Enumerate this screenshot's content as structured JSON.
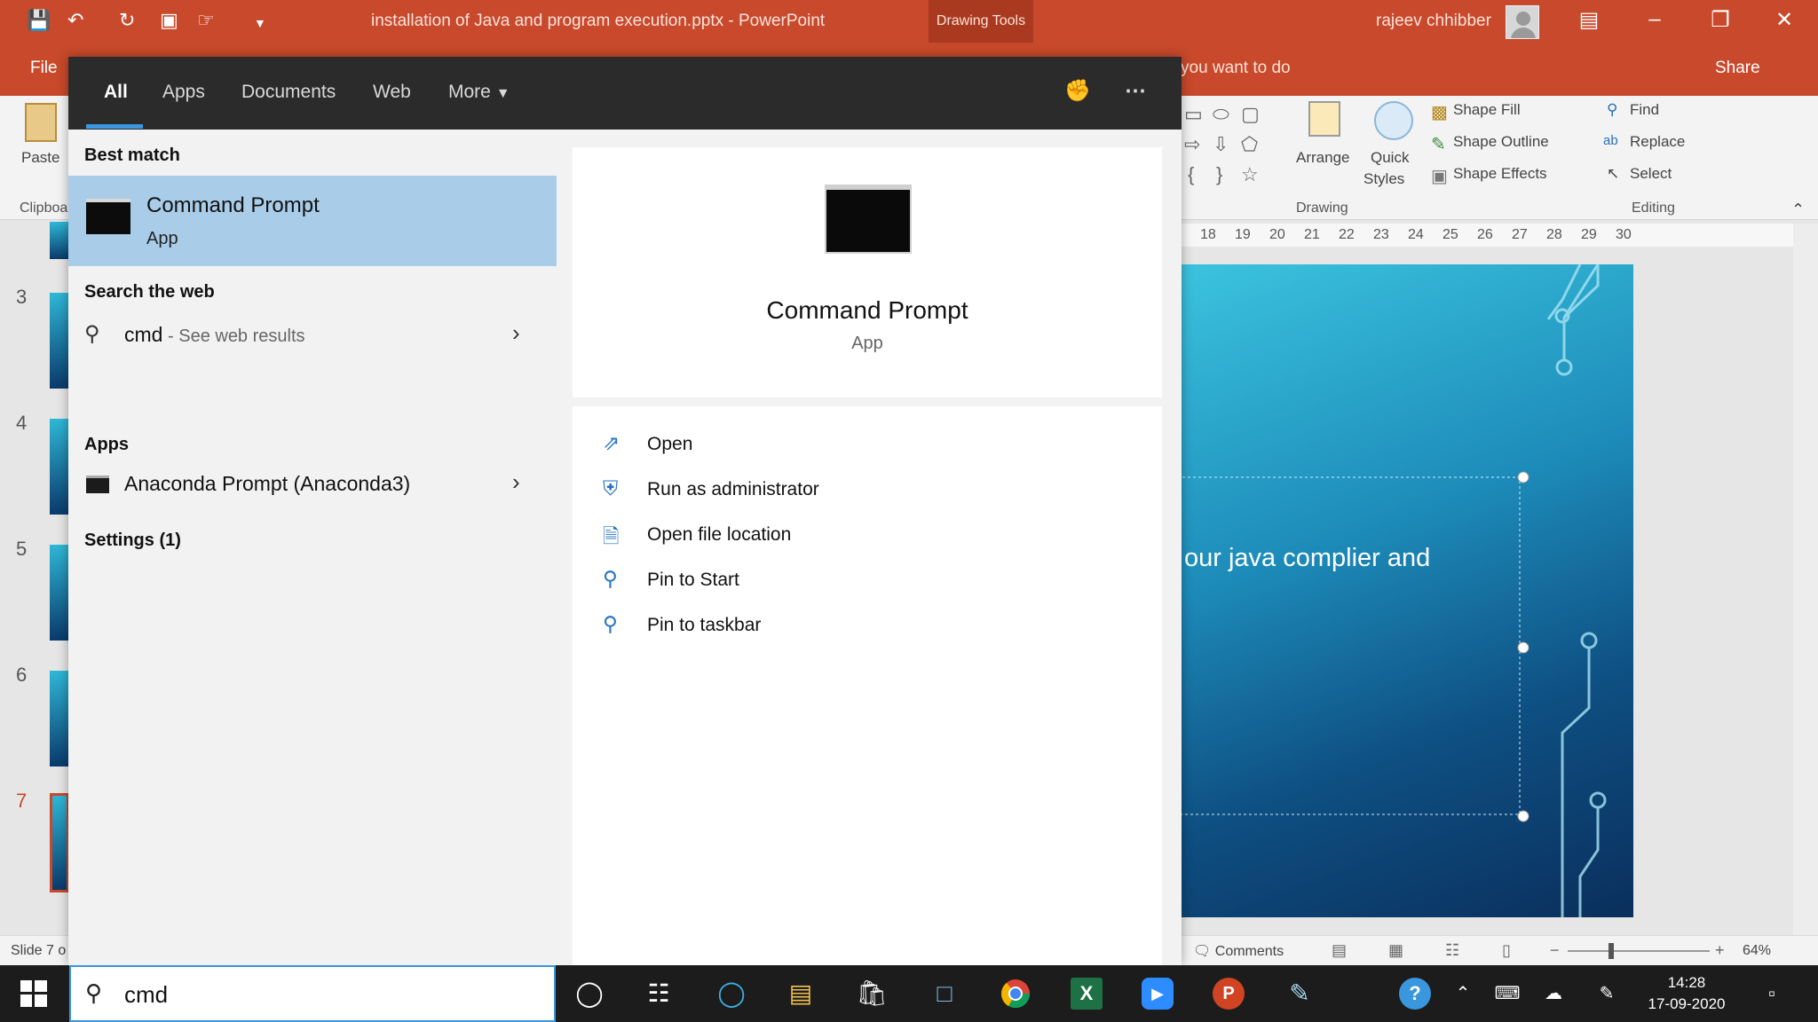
{
  "window": {
    "title": "installation of Java and program execution.pptx  -  PowerPoint",
    "context_tab": "Drawing Tools",
    "user": "rajeev chhibber"
  },
  "ribbon": {
    "file_tab": "File",
    "tell_me": "you want to do",
    "share": "Share",
    "paste": "Paste",
    "clipboard": "Clipboa",
    "arrange": "Arrange",
    "quick_styles_1": "Quick",
    "quick_styles_2": "Styles",
    "shape_fill": "Shape Fill",
    "shape_outline": "Shape Outline",
    "shape_effects": "Shape Effects",
    "find": "Find",
    "replace": "Replace",
    "select": "Select",
    "drawing_group": "Drawing",
    "editing_group": "Editing"
  },
  "ruler": [
    "18",
    "19",
    "20",
    "21",
    "22",
    "23",
    "24",
    "25",
    "26",
    "27",
    "28",
    "29",
    "30"
  ],
  "slides": {
    "numbers": [
      "3",
      "4",
      "5",
      "6",
      "7"
    ],
    "active": "7"
  },
  "slide": {
    "text": "our java complier and"
  },
  "statusbar": {
    "slide_info": "Slide 7 o",
    "comments": "Comments",
    "zoom": "64%"
  },
  "search": {
    "tabs": [
      "All",
      "Apps",
      "Documents",
      "Web",
      "More"
    ],
    "best_match_title": "Best match",
    "best_match": {
      "name": "Command Prompt",
      "type": "App"
    },
    "web_title": "Search the web",
    "web_query": "cmd",
    "web_suffix": " - See web results",
    "apps_title": "Apps",
    "apps": [
      "Anaconda Prompt (Anaconda3)"
    ],
    "settings_title": "Settings (1)",
    "preview": {
      "name": "Command Prompt",
      "type": "App"
    },
    "actions": [
      "Open",
      "Run as administrator",
      "Open file location",
      "Pin to Start",
      "Pin to taskbar"
    ],
    "query": "cmd"
  },
  "taskbar": {
    "time": "14:28",
    "date": "17-09-2020"
  }
}
